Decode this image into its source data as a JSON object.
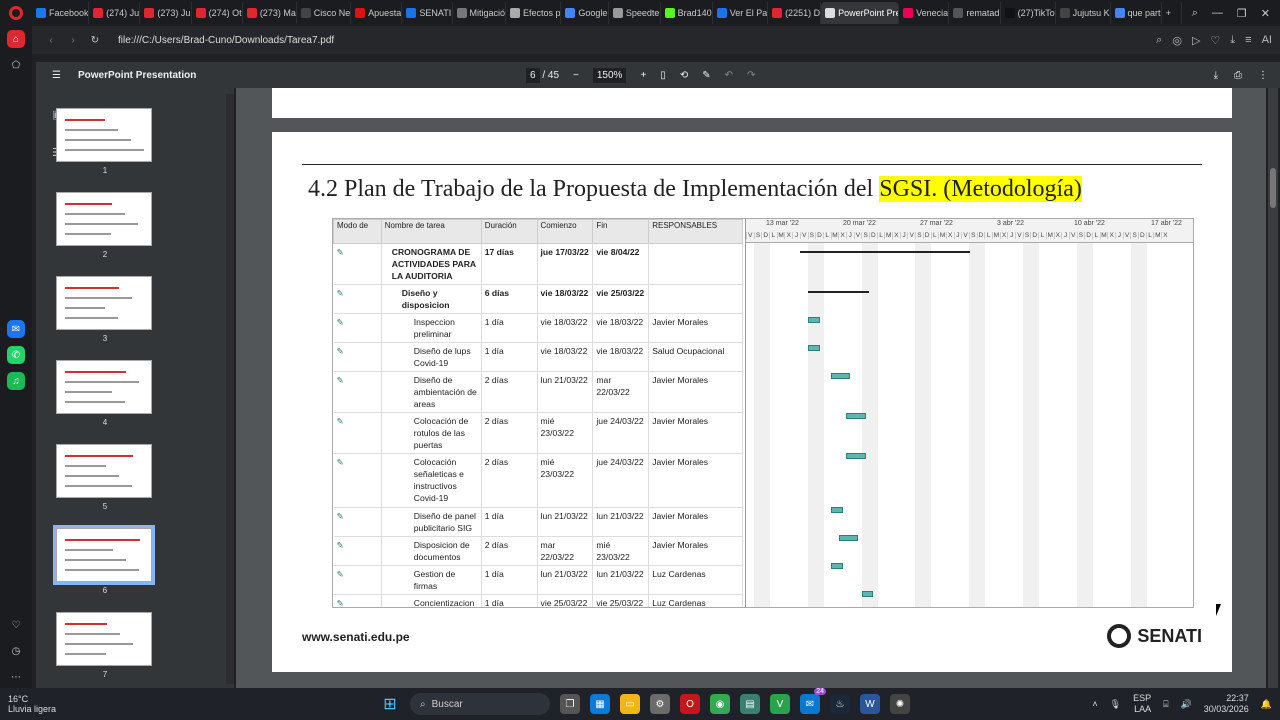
{
  "browser": {
    "tabs": [
      {
        "label": "Facebook",
        "color": "#1877f2"
      },
      {
        "label": "(274) Ju",
        "color": "#e0262f"
      },
      {
        "label": "(273) Ju",
        "color": "#e0262f"
      },
      {
        "label": "(274) Ot",
        "color": "#e0262f"
      },
      {
        "label": "(273) Ma",
        "color": "#e0262f"
      },
      {
        "label": "Cisco Ne",
        "color": "#444"
      },
      {
        "label": "Apuesta",
        "color": "#d11"
      },
      {
        "label": "SENATI",
        "color": "#1a73e8"
      },
      {
        "label": "Mitigació",
        "color": "#777"
      },
      {
        "label": "Efectos p",
        "color": "#aaa"
      },
      {
        "label": "Google",
        "color": "#4285f4"
      },
      {
        "label": "Speedte",
        "color": "#999"
      },
      {
        "label": "Brad140",
        "color": "#53fc18"
      },
      {
        "label": "Ver El Pa",
        "color": "#1f73e8"
      },
      {
        "label": "(2251) D",
        "color": "#e0262f"
      },
      {
        "label": "PowerPoint Pre",
        "color": "#ddd"
      },
      {
        "label": "Venecia",
        "color": "#e05"
      },
      {
        "label": "rematad",
        "color": "#555"
      },
      {
        "label": "(27)TikTo",
        "color": "#111"
      },
      {
        "label": "Jujutsu K",
        "color": "#444"
      },
      {
        "label": "que part",
        "color": "#4285f4"
      }
    ],
    "active_tab_index": 15,
    "url": "file:///C:/Users/Brad-Cuno/Downloads/Tarea7.pdf",
    "ai_label": "AI"
  },
  "pdf": {
    "title": "PowerPoint Presentation",
    "page_current": "6",
    "page_total": "/ 45",
    "zoom": "150%"
  },
  "thumbnails": [
    "1",
    "2",
    "3",
    "4",
    "5",
    "6",
    "7"
  ],
  "selected_thumbnail": "6",
  "slide": {
    "heading_prefix": "4.2 Plan de Trabajo de la Propuesta de Implementación del ",
    "heading_highlight": "SGSI. (Metodología)",
    "footer_url": "www.senati.edu.pe",
    "brand": "SENATI",
    "columns": [
      "Modo de",
      "Nombre de tarea",
      "Duración",
      "Comienzo",
      "Fin",
      "RESPONSABLES"
    ],
    "rows": [
      {
        "name": "CRONOGRAMA DE ACTIVIDADES PARA LA AUDITORIA",
        "dur": "17 días",
        "start": "jue 17/03/22",
        "end": "vie 8/04/22",
        "resp": "",
        "bold": true
      },
      {
        "name": "Diseño y disposicion",
        "dur": "6 días",
        "start": "vie 18/03/22",
        "end": "vie 25/03/22",
        "resp": "",
        "bold": true
      },
      {
        "name": "Inspeccion preliminar",
        "dur": "1 día",
        "start": "vie 18/03/22",
        "end": "vie 18/03/22",
        "resp": "Javier Morales"
      },
      {
        "name": "Diseño de lups Covid-19",
        "dur": "1 día",
        "start": "vie 18/03/22",
        "end": "vie 18/03/22",
        "resp": "Salud Ocupacional"
      },
      {
        "name": "Diseño de ambientación de areas",
        "dur": "2 días",
        "start": "lun 21/03/22",
        "end": "mar 22/03/22",
        "resp": "Javier Morales"
      },
      {
        "name": "Colocación de rotulos de las puertas",
        "dur": "2 días",
        "start": "mié 23/03/22",
        "end": "jue 24/03/22",
        "resp": "Javier Morales"
      },
      {
        "name": "Colocación señaleticas e instructivos Covid-19",
        "dur": "2 días",
        "start": "mié 23/03/22",
        "end": "jue 24/03/22",
        "resp": "Javier Morales"
      },
      {
        "name": "Diseño de panel publicitario SIG",
        "dur": "1 día",
        "start": "lun 21/03/22",
        "end": "lun 21/03/22",
        "resp": "Javier Morales"
      },
      {
        "name": "Disposicion de documentos",
        "dur": "2 días",
        "start": "mar 22/03/22",
        "end": "mié 23/03/22",
        "resp": "Javier Morales"
      },
      {
        "name": "Gestion de firmas",
        "dur": "1 día",
        "start": "lun 21/03/22",
        "end": "lun 21/03/22",
        "resp": "Luz Cardenas"
      },
      {
        "name": "Concientizacion sobre el uso de",
        "dur": "1 día",
        "start": "vie 25/03/22",
        "end": "vie 25/03/22",
        "resp": "Luz Cardenas"
      }
    ],
    "gantt_weeks": [
      "13 mar '22",
      "20 mar '22",
      "27 mar '22",
      "3 abr '22",
      "10 abr '22",
      "17 abr '22"
    ],
    "gantt_days": "V S D L M X J V S D L M X J V S D L M X J V S D L M X J V S D L M X J V S D L M X J V S D L M X J V S D L M X",
    "gantt_bars": [
      {
        "start": 18,
        "days": 1
      },
      {
        "start": 18,
        "days": 1
      },
      {
        "start": 21,
        "days": 2
      },
      {
        "start": 23,
        "days": 2
      },
      {
        "start": 23,
        "days": 2
      },
      {
        "start": 21,
        "days": 1
      },
      {
        "start": 22,
        "days": 2
      },
      {
        "start": 21,
        "days": 1
      },
      {
        "start": 25,
        "days": 1
      }
    ]
  },
  "taskbar": {
    "weather_temp": "16°C",
    "weather_desc": "Lluvia ligera",
    "search": "Buscar",
    "badge": "24",
    "lang": "ESP",
    "region": "LAA",
    "time": "22:37",
    "date": "30/03/2026"
  }
}
